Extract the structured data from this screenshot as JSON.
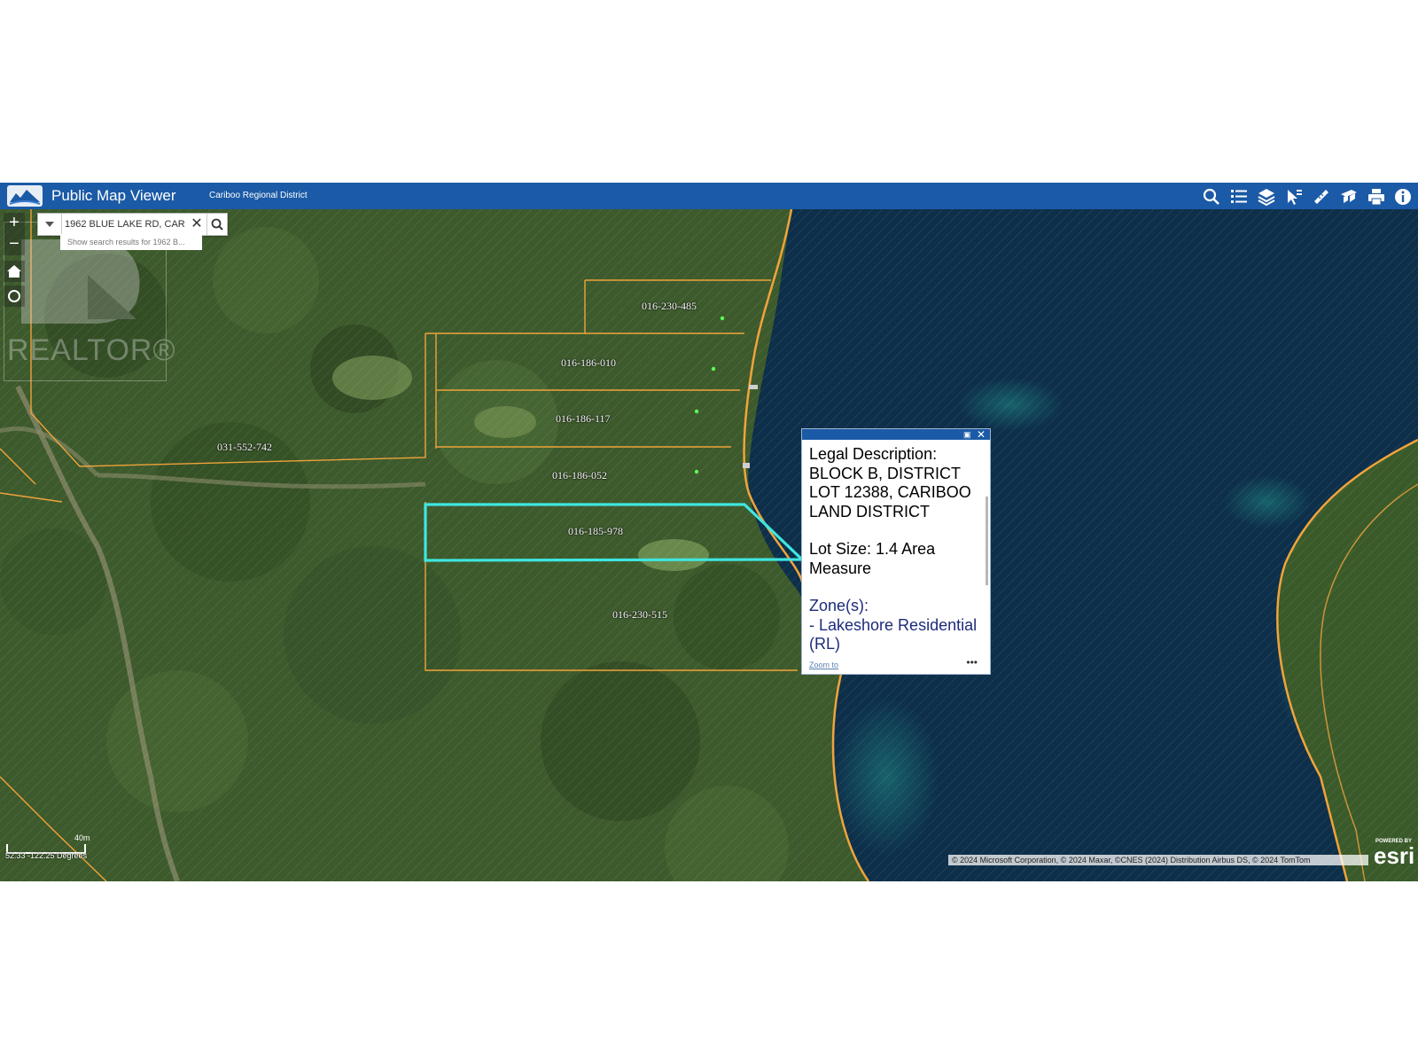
{
  "header": {
    "title": "Public Map Viewer",
    "organization": "Cariboo Regional District",
    "logo_text": "Cariboo Regional District",
    "tools": [
      "search-icon",
      "legend-list-icon",
      "layers-icon",
      "identify-icon",
      "measure-icon",
      "bookmark-icon",
      "print-icon",
      "info-icon"
    ],
    "bar_color": "#1b5aa6"
  },
  "search": {
    "value": "1962 BLUE LAKE RD, CAR",
    "suggestion": "Show search results for 1962 B..."
  },
  "map_controls": {
    "zoom_in": "+",
    "zoom_out": "−"
  },
  "parcels": [
    {
      "id": "p1",
      "label": "016-230-485"
    },
    {
      "id": "p2",
      "label": "016-186-010"
    },
    {
      "id": "p3",
      "label": "016-186-117"
    },
    {
      "id": "p4",
      "label": "016-186-052"
    },
    {
      "id": "p5",
      "label": "016-185-978",
      "selected": true
    },
    {
      "id": "p6",
      "label": "016-230-515"
    },
    {
      "id": "p7",
      "label": "031-552-742"
    }
  ],
  "popup": {
    "legal_heading": "Legal Description:",
    "legal_value": "BLOCK B, DISTRICT LOT 12388, CARIBOO LAND DISTRICT",
    "lot_size": "Lot Size: 1.4 Area Measure",
    "zone_heading": "Zone(s):",
    "zone_value": "- Lakeshore Residential (RL)",
    "zoom_link": "Zoom to",
    "more": "•••"
  },
  "scale": {
    "label": "40m",
    "coordinates": "52.33 -122.25 Degrees"
  },
  "attribution": "© 2024 Microsoft Corporation, © 2024 Maxar, ©CNES (2024) Distribution Airbus DS, © 2024 TomTom",
  "esri": {
    "powered_by": "POWERED BY",
    "logo": "esri"
  },
  "watermark": "REALTOR®",
  "colors": {
    "parcel_line": "#f0a33a",
    "selected_parcel": "#3fe6e0",
    "forest": "#3d5a2c",
    "lake": "#0d2f4a"
  }
}
